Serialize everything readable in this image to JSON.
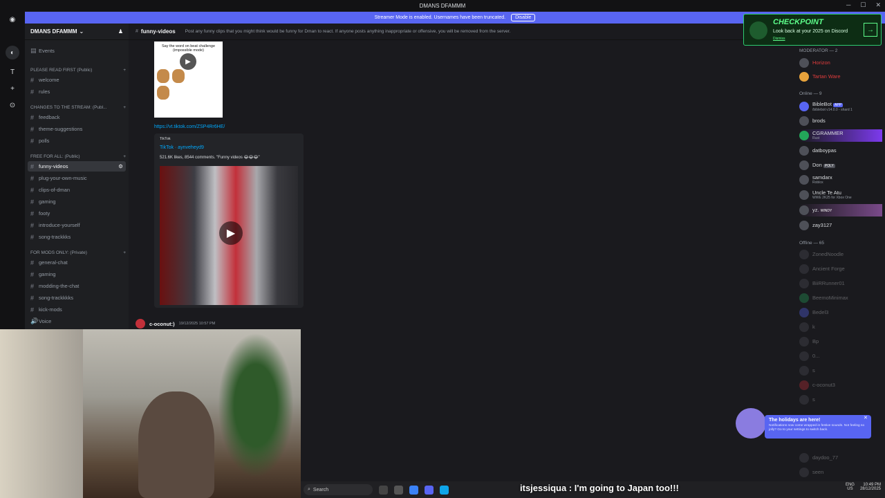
{
  "window": {
    "title": "DMANS DFAMMM"
  },
  "banner": {
    "text": "Streamer Mode is enabled. Usernames have been truncated.",
    "button": "Disable"
  },
  "server": {
    "name": "DMANS DFAMMM"
  },
  "sidebar": {
    "events": "Events",
    "categories": [
      {
        "label": "PLEASE READ FIRST (Public)"
      },
      {
        "label": "CHANGES TO THE STREAM: (Publ..."
      },
      {
        "label": "FREE FOR ALL: (Public)"
      },
      {
        "label": "FOR MODS ONLY: (Private)"
      }
    ],
    "channels": [
      "welcome",
      "rules",
      "feedback",
      "theme-suggestions",
      "polls",
      "funny-videos",
      "plug-your-own-music",
      "clips-of-dman",
      "gaming",
      "footy",
      "introduce-yourself",
      "song-trackkks",
      "general-chat",
      "gaming",
      "modding-the-chat",
      "song-trackkkks",
      "kick-mods"
    ],
    "voice": "Voice"
  },
  "channel": {
    "name": "funny-videos",
    "topic": "Post any funny clips that you might think would be funny for Dman to react. If anyone posts anything inappropriate or offensive, you will be removed from the server."
  },
  "messages": {
    "thumb_caption": "Say the word on beat challenge (impossible mode)",
    "link": "https://vt.tiktok.com/ZSP4Rr6HE/",
    "embed_provider": "TikTok",
    "embed_title": "TikTok · aynveheyd9",
    "embed_desc": "521.6K likes, 8544 comments. \"Funny videos 😂😂😂\"",
    "next_author": "c-oconut:)",
    "next_time": "19/12/2025 10:57 PM"
  },
  "members": {
    "moderator_header": "MODERATOR — 2",
    "online_header": "Online — 9",
    "offline_header": "Offline — 65",
    "moderators": [
      "Horizon",
      "Tartan Ware"
    ],
    "online": [
      {
        "name": "BibleBot",
        "badge": "APP",
        "sub": "/biblebot v14.0.0 - shard 1"
      },
      {
        "name": "brods",
        "sub": ""
      },
      {
        "name": "CGRAMMER",
        "sub": "Rust"
      },
      {
        "name": "datboypas",
        "sub": ""
      },
      {
        "name": "Don",
        "badge": "POLY",
        "sub": ""
      },
      {
        "name": "samdarx",
        "sub": "Roblox"
      },
      {
        "name": "Uncle Te Atu",
        "sub": "WWE 2K25 for Xbox One"
      },
      {
        "name": "yz.",
        "badge": "WINDY",
        "sub": ""
      },
      {
        "name": "zay3127",
        "sub": ""
      }
    ],
    "offline": [
      "ZonedNoodle",
      "Ancient Forge",
      "BiiRRunner01",
      "BeemoMinimax",
      "Bedel3",
      "k",
      "Bp",
      "0...",
      "s",
      "c-oconut3",
      "s",
      "daydoo_77",
      "seen"
    ]
  },
  "checkpoint": {
    "title": "CHECKPOINT",
    "subtitle": "Look back at your 2025 on Discord",
    "link": "Dismiss"
  },
  "holidays": {
    "title": "The holidays are here!",
    "body": "Notifications now come wrapped in festive sounds. Not feeling so jolly? Go to your settings to switch back."
  },
  "taskbar": {
    "search": "Search",
    "caption": "itsjessiqua : I'm going to Japan too!!!",
    "lang1": "ENG",
    "lang2": "US",
    "time": "10:49 PM",
    "date": "28/12/2025"
  },
  "colors": {
    "accent": "#5865f2",
    "link": "#00a8fc",
    "mod": "#e03c3c",
    "green": "#23a55a"
  }
}
